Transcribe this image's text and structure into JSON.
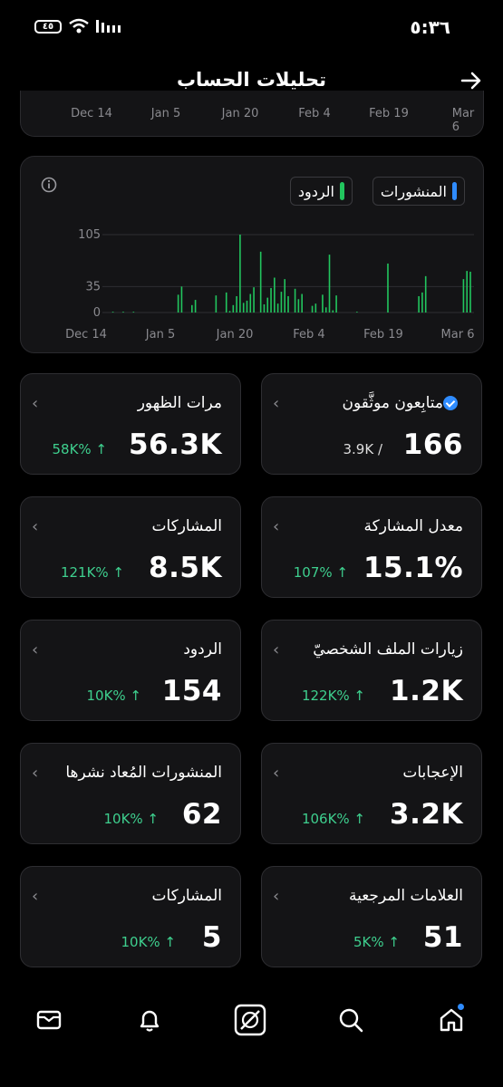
{
  "status": {
    "time": "٥:٣٦",
    "battery": "٤٥"
  },
  "header": {
    "title": "تحليلات الحساب"
  },
  "top_axis": [
    "Dec 14",
    "Jan 5",
    "Jan 20",
    "Feb 4",
    "Feb 19",
    "Mar 6"
  ],
  "legend": {
    "posts": "المنشورات",
    "replies": "الردود",
    "posts_color": "#2f8cff",
    "replies_color": "#22c55e"
  },
  "chart_data": {
    "type": "bar",
    "title": "",
    "xlabel": "",
    "ylabel": "",
    "x_ticks": [
      "Dec 14",
      "Jan 5",
      "Jan 20",
      "Feb 4",
      "Feb 19",
      "Mar 6"
    ],
    "y_ticks": [
      0,
      35,
      105
    ],
    "ylim": [
      0,
      105
    ],
    "grid": true,
    "series": [
      {
        "name": "المنشورات",
        "color": "#22c55e",
        "values": [
          0,
          0,
          1,
          0,
          0,
          1,
          0,
          0,
          1,
          0,
          0,
          0,
          0,
          0,
          0,
          0,
          0,
          0,
          0,
          0,
          0,
          24,
          35,
          0,
          0,
          10,
          17,
          0,
          0,
          0,
          0,
          0,
          23,
          0,
          0,
          27,
          2,
          10,
          22,
          105,
          13,
          16,
          25,
          34,
          0,
          82,
          11,
          20,
          33,
          47,
          12,
          28,
          45,
          22,
          0,
          32,
          18,
          25,
          0,
          0,
          9,
          12,
          0,
          24,
          7,
          78,
          3,
          23,
          0,
          0,
          0,
          0,
          0,
          1,
          0,
          0,
          0,
          0,
          0,
          0,
          0,
          0,
          66,
          0,
          0,
          0,
          0,
          0,
          0,
          0,
          0,
          22,
          27,
          49,
          0,
          0,
          0,
          0,
          0,
          0,
          0,
          0,
          0,
          0,
          45,
          56,
          55
        ]
      }
    ]
  },
  "tiles": [
    {
      "label": "متابِعون موثَّقون",
      "value": "166",
      "sub": "3.9K /",
      "change": "",
      "verified": true
    },
    {
      "label": "مرات الظهور",
      "value": "56.3K",
      "sub": "",
      "change": "58K% ↑",
      "verified": false
    },
    {
      "label": "معدل المشاركة",
      "value": "15.1%",
      "sub": "",
      "change": "107% ↑",
      "verified": false
    },
    {
      "label": "المشاركات",
      "value": "8.5K",
      "sub": "",
      "change": "121K% ↑",
      "verified": false
    },
    {
      "label": "زيارات الملف الشخصيّ",
      "value": "1.2K",
      "sub": "",
      "change": "122K% ↑",
      "verified": false
    },
    {
      "label": "الردود",
      "value": "154",
      "sub": "",
      "change": "10K% ↑",
      "verified": false
    },
    {
      "label": "الإعجابات",
      "value": "3.2K",
      "sub": "",
      "change": "106K% ↑",
      "verified": false
    },
    {
      "label": "المنشورات المُعاد نشرها",
      "value": "62",
      "sub": "",
      "change": "10K% ↑",
      "verified": false
    },
    {
      "label": "العلامات المرجعية",
      "value": "51",
      "sub": "",
      "change": "5K% ↑",
      "verified": false
    },
    {
      "label": "المشاركات",
      "value": "5",
      "sub": "",
      "change": "10K% ↑",
      "verified": false
    }
  ],
  "nav": [
    "home-icon",
    "search-icon",
    "grok-icon",
    "bell-icon",
    "mail-icon"
  ]
}
